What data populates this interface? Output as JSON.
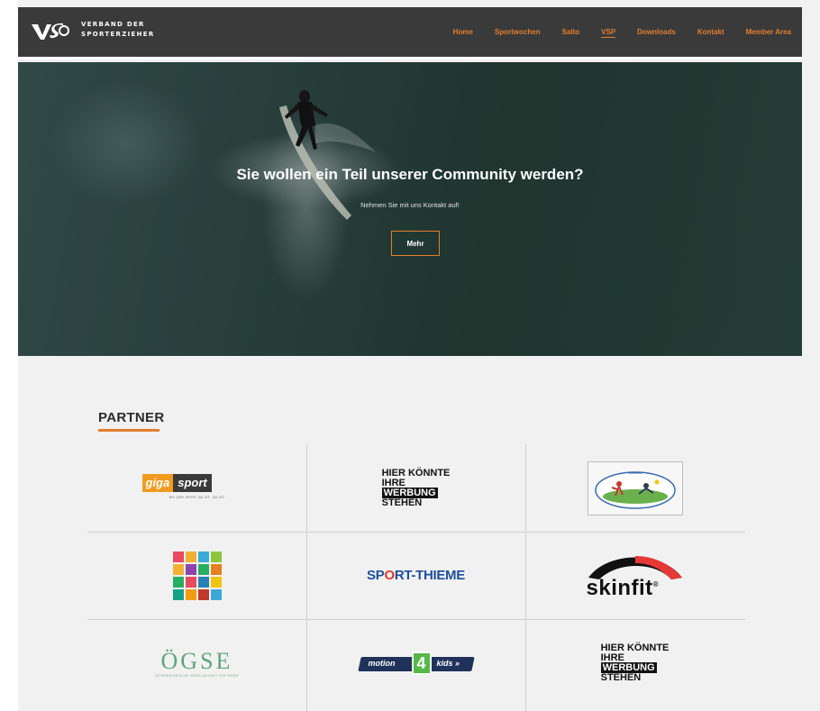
{
  "brand": {
    "logo": "VSP",
    "name_line1": "VERBAND DER",
    "name_line2": "SPORTERZIEHER"
  },
  "nav": {
    "items": [
      {
        "label": "Home"
      },
      {
        "label": "Sportwochen"
      },
      {
        "label": "Salto"
      },
      {
        "label": "VSP",
        "active": true
      },
      {
        "label": "Downloads"
      },
      {
        "label": "Kontakt"
      },
      {
        "label": "Member Area"
      }
    ]
  },
  "hero": {
    "title": "Sie wollen ein Teil unserer Community werden?",
    "subtitle": "Nehmen Sie mit uns Kontakt auf!",
    "button_label": "Mehr"
  },
  "partner": {
    "heading": "PARTNER",
    "logos": {
      "giga_left": "giga",
      "giga_right": "sport",
      "giga_tagline": "WO DER SPORT DA IST, DA IST",
      "hier_1": {
        "line1": "HIER KÖNNTE",
        "line2": "IHRE",
        "line3": "WERBUNG",
        "line4": "STEHEN"
      },
      "hier_2": {
        "line1": "HIER KÖNNTE",
        "line2": "IHRE",
        "line3": "WERBUNG",
        "line4": "STEHEN"
      },
      "sport_thieme_a": "SP",
      "sport_thieme_o": "O",
      "sport_thieme_b": "RT-THIEME",
      "skinfit": "skinfit",
      "skinfit_mark": "®",
      "ogse": "ÖGSE",
      "ogse_sub": "ÖSTERREICHISCHE GESELLSCHAFT FÜR SPORT",
      "motion_left": "motion",
      "motion_num": "4",
      "motion_right": "kids »"
    }
  },
  "colors": {
    "accent": "#e37e2f",
    "header_bg": "#3a3a3a",
    "section_bg": "#f1f1f1"
  }
}
